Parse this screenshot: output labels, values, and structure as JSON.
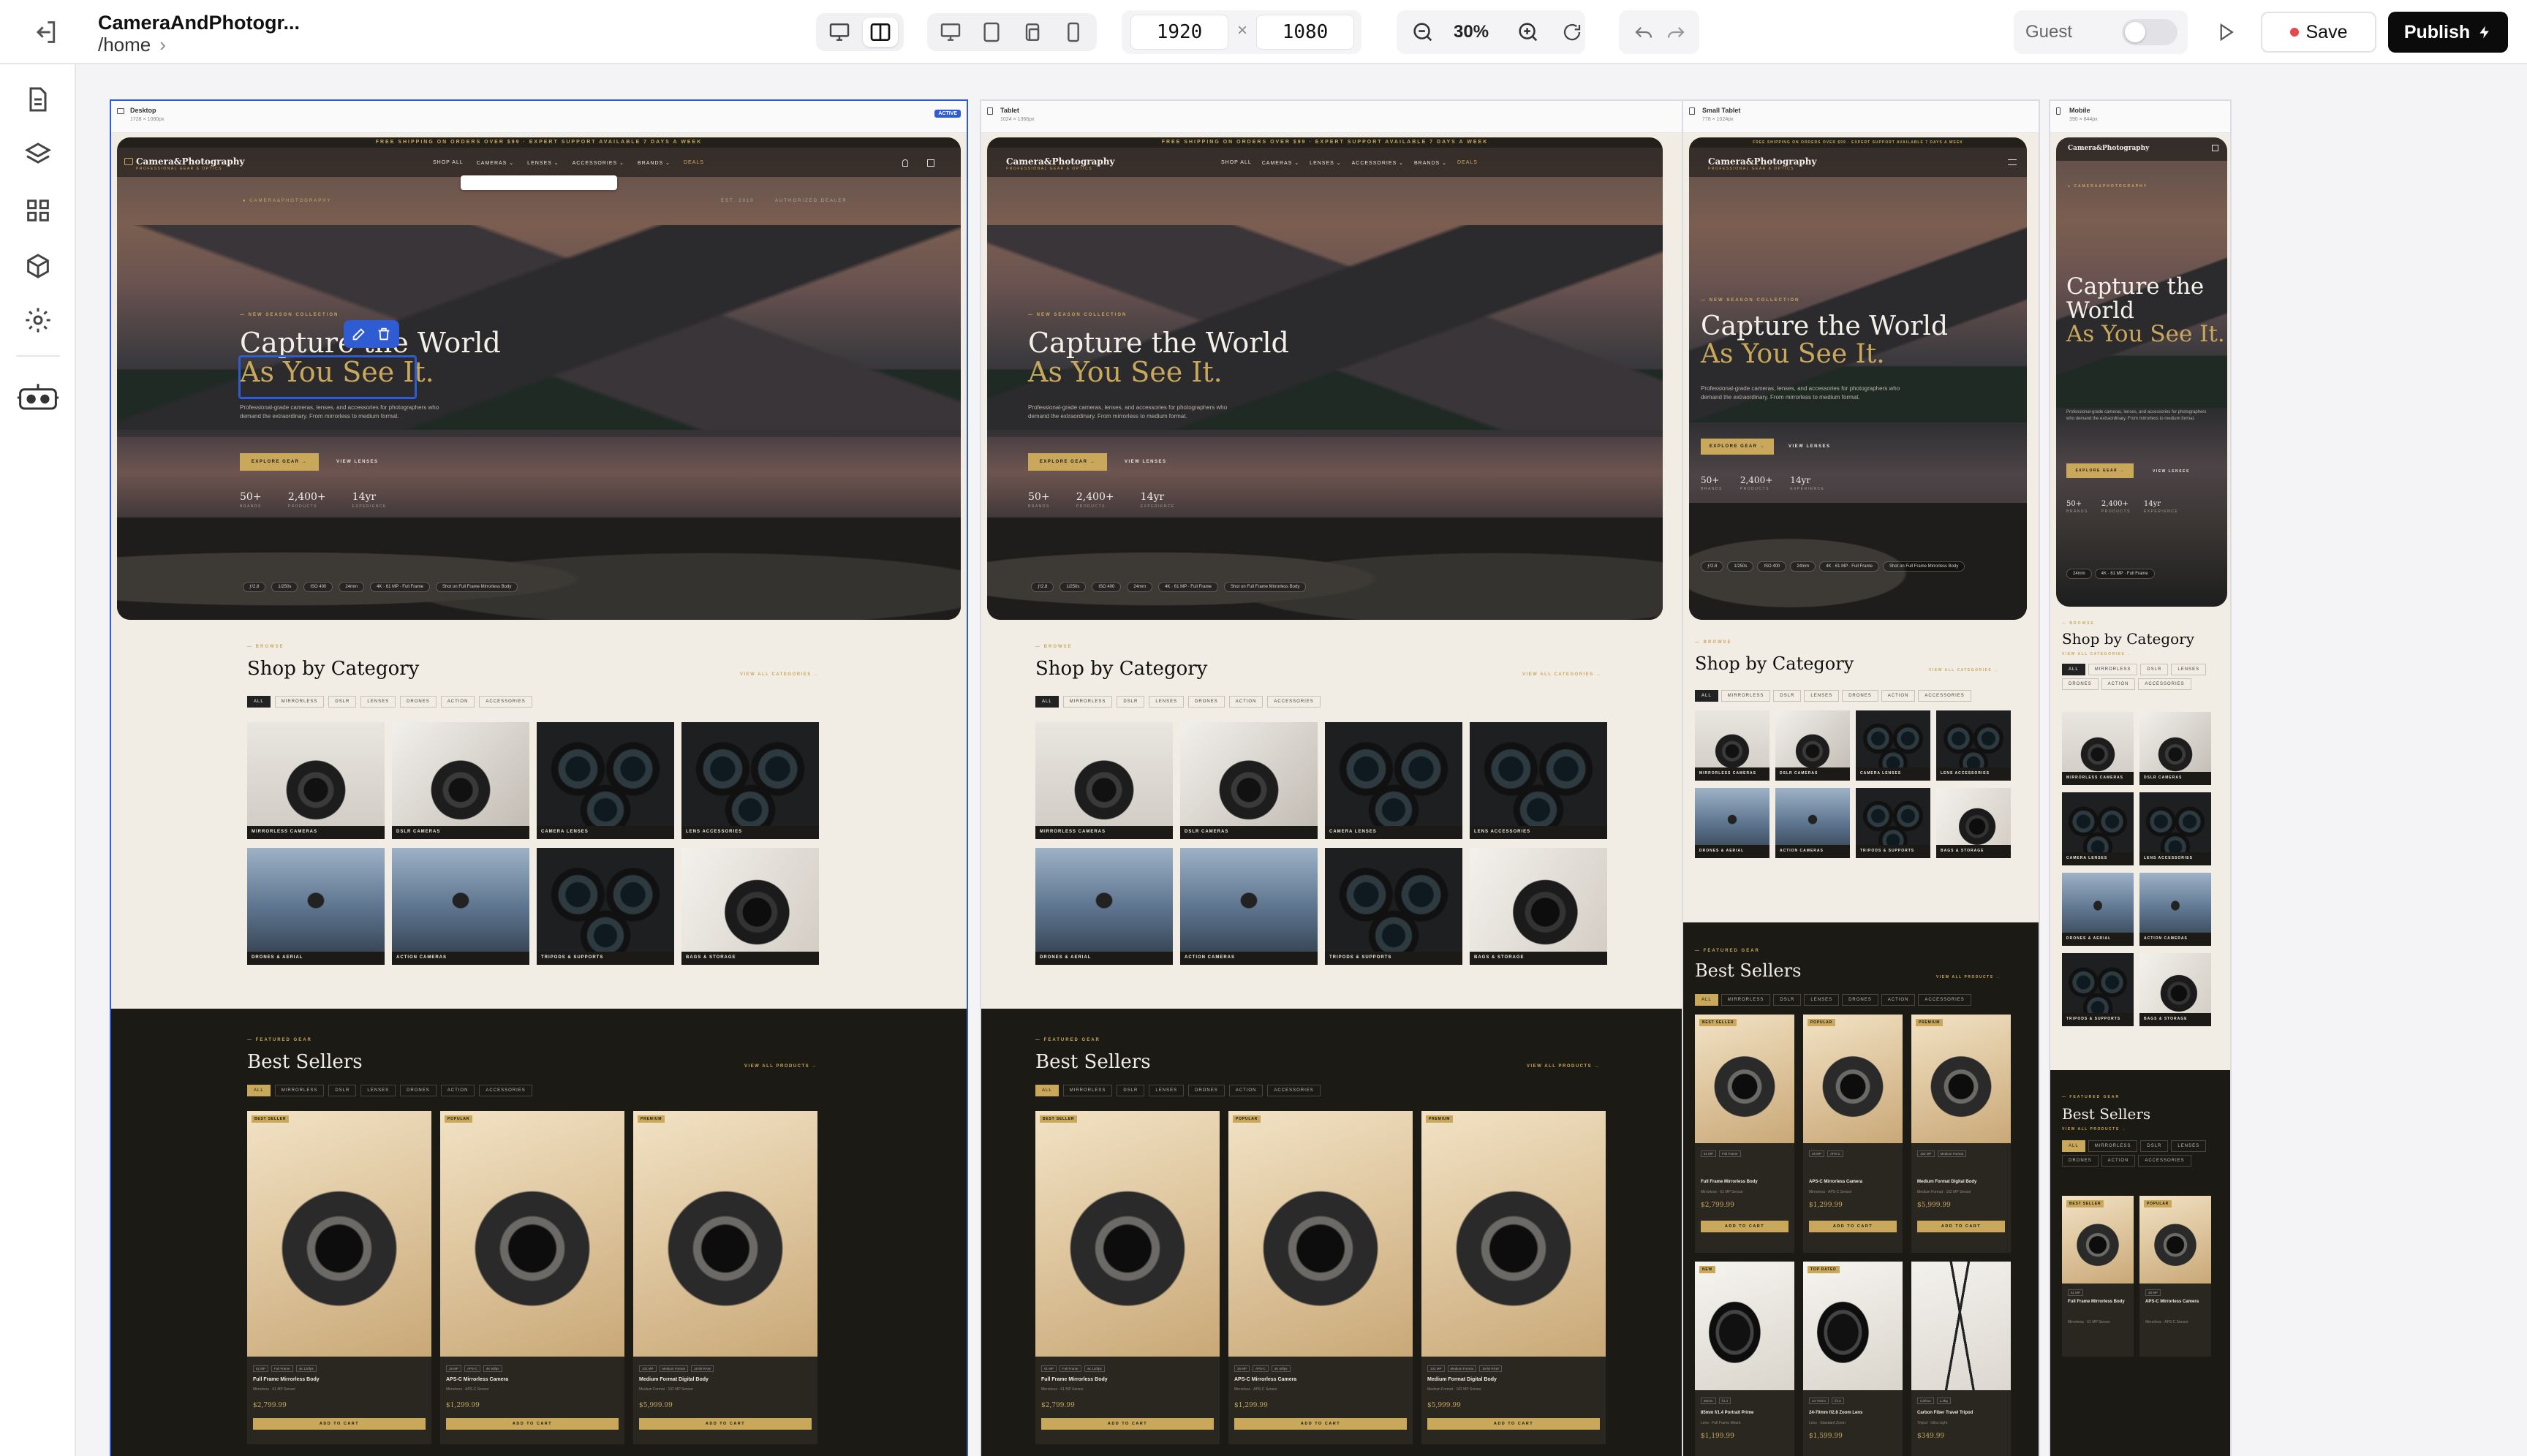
{
  "header": {
    "project_title": "CameraAndPhotogr...",
    "route": "/home",
    "width": "1920",
    "height": "1080",
    "times": "×",
    "zoom": "30%",
    "guest_label": "Guest",
    "save_label": "Save",
    "publish_label": "Publish"
  },
  "frames": [
    {
      "name": "Desktop",
      "size": "1728 × 1080px",
      "active_badge": "ACTIVE"
    },
    {
      "name": "Tablet",
      "size": "1024 × 1366px"
    },
    {
      "name": "Small Tablet",
      "size": "778 × 1024px"
    },
    {
      "name": "Mobile",
      "size": "390 × 844px"
    }
  ],
  "site": {
    "promo": "FREE SHIPPING ON ORDERS OVER $99 · EXPERT SUPPORT AVAILABLE 7 DAYS A WEEK",
    "logo": "Camera&Photography",
    "logo_sub": "PROFESSIONAL GEAR & OPTICS",
    "nav": [
      "SHOP ALL",
      "CAMERAS ⌄",
      "LENSES ⌄",
      "ACCESSORIES ⌄",
      "BRANDS ⌄",
      "DEALS"
    ],
    "hero_tag": "● CAMERA&PHOTOGRAPHY",
    "hero_est": "EST. 2010",
    "hero_dealer": "AUTHORIZED DEALER",
    "eyebrow": "— NEW SEASON COLLECTION",
    "headline_1": "Capture the World",
    "headline_2": "As You See It.",
    "hero_desc": "Professional-grade cameras, lenses, and accessories for photographers who demand the extraordinary. From mirrorless to medium format.",
    "cta_primary": "EXPLORE GEAR →",
    "cta_secondary": "VIEW LENSES",
    "stats": [
      {
        "value": "50+",
        "label": "BRANDS"
      },
      {
        "value": "2,400+",
        "label": "PRODUCTS"
      },
      {
        "value": "14yr",
        "label": "EXPERIENCE"
      }
    ],
    "chips": [
      "ƒ/2.8",
      "1/250s",
      "ISO 400",
      "24mm",
      "4K · 61 MP · Full Frame",
      "Shot on Full Frame Mirrorless Body"
    ],
    "category_eyebrow": "— BROWSE",
    "category_title": "Shop by Category",
    "category_view_all": "VIEW ALL CATEGORIES →",
    "filters": [
      "ALL",
      "MIRRORLESS",
      "DSLR",
      "LENSES",
      "DRONES",
      "ACTION",
      "ACCESSORIES"
    ],
    "categories": [
      "MIRRORLESS CAMERAS",
      "DSLR CAMERAS",
      "CAMERA LENSES",
      "LENS ACCESSORIES",
      "DRONES & AERIAL",
      "ACTION CAMERAS",
      "TRIPODS & SUPPORTS",
      "BAGS & STORAGE"
    ],
    "best_eyebrow": "— FEATURED GEAR",
    "best_title": "Best Sellers",
    "best_view_all": "VIEW ALL PRODUCTS →",
    "products": [
      {
        "badge": "BEST SELLER",
        "tags": [
          "61 MP",
          "Full Frame",
          "4K 120fps"
        ],
        "name": "Full Frame Mirrorless Body",
        "sub": "Mirrorless · 61 MP Sensor",
        "price": "$2,799.99"
      },
      {
        "badge": "POPULAR",
        "tags": [
          "26 MP",
          "APS-C",
          "4K 60fps"
        ],
        "name": "APS-C Mirrorless Camera",
        "sub": "Mirrorless · APS-C Sensor",
        "price": "$1,299.99"
      },
      {
        "badge": "PREMIUM",
        "tags": [
          "102 MP",
          "Medium Format",
          "16-bit RAW"
        ],
        "name": "Medium Format Digital Body",
        "sub": "Medium Format · 102 MP Sensor",
        "price": "$5,999.99"
      },
      {
        "badge": "NEW",
        "tags": [
          "85mm",
          "f/1.4"
        ],
        "name": "85mm f/1.4 Portrait Prime",
        "sub": "Lens · Full Frame Mount",
        "price": "$1,199.99"
      },
      {
        "badge": "TOP RATED",
        "tags": [
          "24-70mm",
          "f/2.8"
        ],
        "name": "24-70mm f/2.8 Zoom Lens",
        "sub": "Lens · Standard Zoom",
        "price": "$1,599.99"
      },
      {
        "badge": "",
        "tags": [
          "Carbon",
          "1.4kg"
        ],
        "name": "Carbon Fiber Travel Tripod",
        "sub": "Tripod · Ultra Light",
        "price": "$349.99"
      }
    ],
    "add_to_cart": "ADD TO CART"
  },
  "colors": {
    "accent_gold": "#c9a85c",
    "selection_blue": "#2f5bd3",
    "save_dot": "#e5484d"
  }
}
